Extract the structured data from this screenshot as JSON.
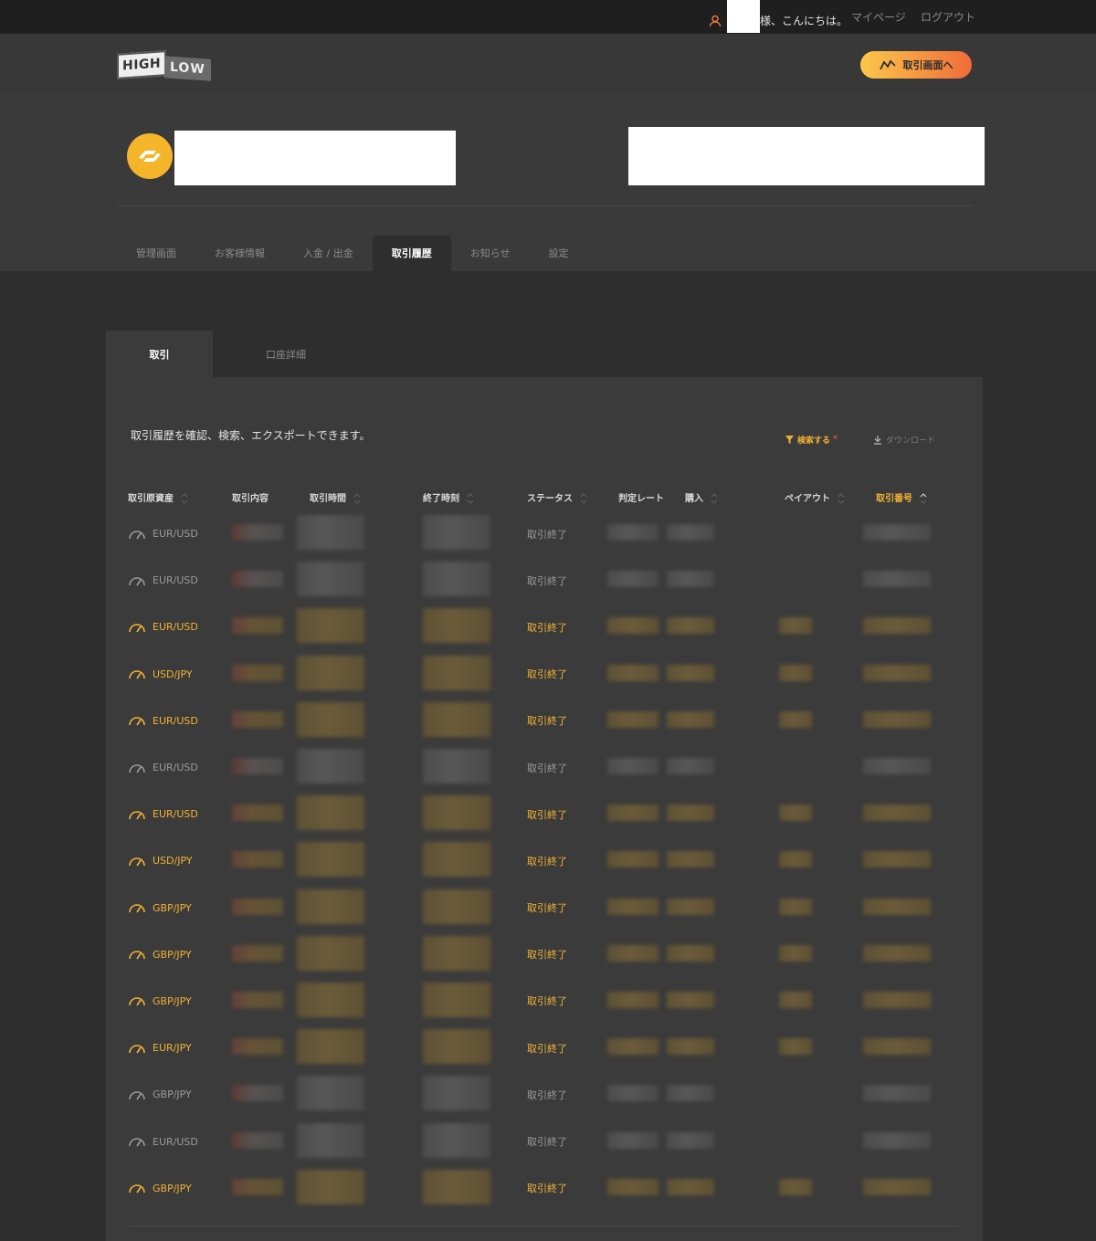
{
  "topbar": {
    "greeting": "様、こんにちは。",
    "mypage": "マイページ",
    "logout": "ログアウト"
  },
  "header": {
    "logo_high": "HIGH",
    "logo_low": "LOW",
    "trade_button": "取引画面へ"
  },
  "nav_tabs": [
    {
      "label": "管理画面",
      "active": false
    },
    {
      "label": "お客様情報",
      "active": false
    },
    {
      "label": "入金 / 出金",
      "active": false
    },
    {
      "label": "取引履歴",
      "active": true
    },
    {
      "label": "お知らせ",
      "active": false
    },
    {
      "label": "設定",
      "active": false
    }
  ],
  "sub_tabs": [
    {
      "label": "取引",
      "active": true
    },
    {
      "label": "口座詳細",
      "active": false
    }
  ],
  "panel": {
    "description": "取引履歴を確認、検索、エクスポートできます。",
    "search_label": "検索する",
    "search_x": "×",
    "download_label": "ダウンロード"
  },
  "table": {
    "columns": [
      "取引原資産",
      "取引内容",
      "取引時間",
      "終了時刻",
      "ステータス",
      "判定レート",
      "購入",
      "ペイアウト",
      "取引番号"
    ],
    "rows": [
      {
        "asset": "EUR/USD",
        "status": "取引終了",
        "result": "loss"
      },
      {
        "asset": "EUR/USD",
        "status": "取引終了",
        "result": "loss"
      },
      {
        "asset": "EUR/USD",
        "status": "取引終了",
        "result": "win"
      },
      {
        "asset": "USD/JPY",
        "status": "取引終了",
        "result": "win"
      },
      {
        "asset": "EUR/USD",
        "status": "取引終了",
        "result": "win"
      },
      {
        "asset": "EUR/USD",
        "status": "取引終了",
        "result": "loss"
      },
      {
        "asset": "EUR/USD",
        "status": "取引終了",
        "result": "win"
      },
      {
        "asset": "USD/JPY",
        "status": "取引終了",
        "result": "win"
      },
      {
        "asset": "GBP/JPY",
        "status": "取引終了",
        "result": "win"
      },
      {
        "asset": "GBP/JPY",
        "status": "取引終了",
        "result": "win"
      },
      {
        "asset": "GBP/JPY",
        "status": "取引終了",
        "result": "win"
      },
      {
        "asset": "EUR/JPY",
        "status": "取引終了",
        "result": "win"
      },
      {
        "asset": "GBP/JPY",
        "status": "取引終了",
        "result": "loss"
      },
      {
        "asset": "EUR/USD",
        "status": "取引終了",
        "result": "loss"
      },
      {
        "asset": "GBP/JPY",
        "status": "取引終了",
        "result": "win"
      }
    ]
  },
  "colors": {
    "accent": "#f2b233",
    "button_gradient_start": "#fbc84a",
    "button_gradient_end": "#f06b3a",
    "background": "#2e2e2e",
    "panel": "#3b3b3b"
  }
}
